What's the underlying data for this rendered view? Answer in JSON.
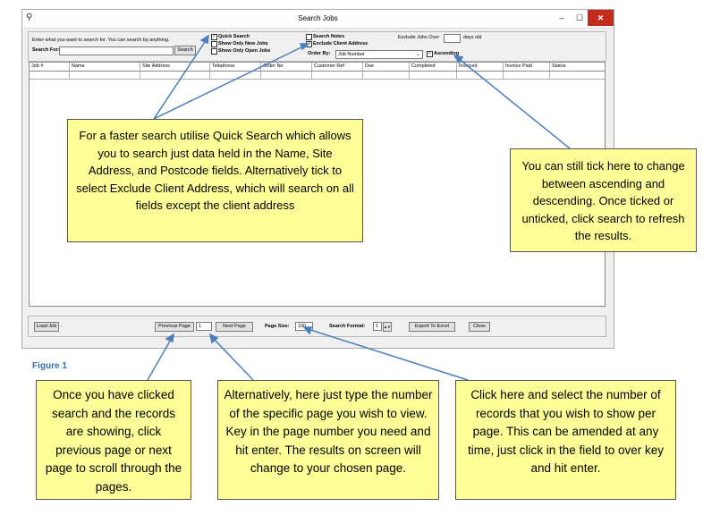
{
  "window": {
    "title": "Search Jobs",
    "controls": {
      "minimize": "–",
      "maximize": "☐",
      "close": "✕"
    }
  },
  "search_panel": {
    "hint": "Enter what you want to search for.  You can search by anything.",
    "search_for_label": "Search For:",
    "search_for_value": "",
    "search_button": "Search",
    "quick_search": {
      "label": "Quick Search",
      "checked": true
    },
    "show_only_new_jobs": {
      "label": "Show Only New Jobs",
      "checked": false
    },
    "show_only_open_jobs": {
      "label": "Show Only Open Jobs",
      "checked": false
    },
    "search_notes": {
      "label": "Search Notes",
      "checked": false
    },
    "exclude_client_address": {
      "label": "Exclude Client Address",
      "checked": true
    },
    "exclude_jobs_over_label": "Exclude Jobs Over",
    "exclude_jobs_over_value": "",
    "days_old_label": "days old",
    "order_by_label": "Order By:",
    "order_by_value": "Job Number",
    "ascending": {
      "label": "Ascending",
      "checked": true
    }
  },
  "grid": {
    "columns": [
      "Job #",
      "Name",
      "Site Address",
      "Telephone",
      "Order No",
      "Customer Ref",
      "Due",
      "Completed",
      "Invoiced",
      "Invoice Paid",
      "Status"
    ]
  },
  "bottom_bar": {
    "load_job": "Load Job",
    "load_job_suffix": ".",
    "previous_page": "Previous Page",
    "page_number": "1",
    "next_page": "Next Page",
    "page_size_label": "Page Size:",
    "page_size_value": "100",
    "search_format_label": "Search Format:",
    "search_format_value": "1",
    "export_to_excel": "Export To Excel",
    "close": "Close"
  },
  "figure_label": "Figure 1",
  "callouts": {
    "quick_search": "For a faster search utilise Quick Search which allows you to search just data held in the Name, Site Address, and Postcode fields. Alternatively tick to select Exclude Client Address, which will search on all fields except the client address",
    "ascending": "You can still tick here to change between ascending and descending. Once ticked or unticked, click search to refresh the results.",
    "prev_next": "Once you have clicked search and the records are showing, click previous page or next page to scroll through the pages.",
    "page_number": "Alternatively, here just type the number of the specific page you wish to view. Key in the page number you need and hit enter. The results on screen will change to your chosen page.",
    "page_size": "Click here and select the number of records that you wish to show per page. This can be amended at any time, just click in the field to over key and hit enter."
  },
  "colors": {
    "callout_fill": "#ffff99",
    "arrow": "#4a7ebb",
    "figure_label": "#2e74b5",
    "close_button": "#c42b1c"
  }
}
